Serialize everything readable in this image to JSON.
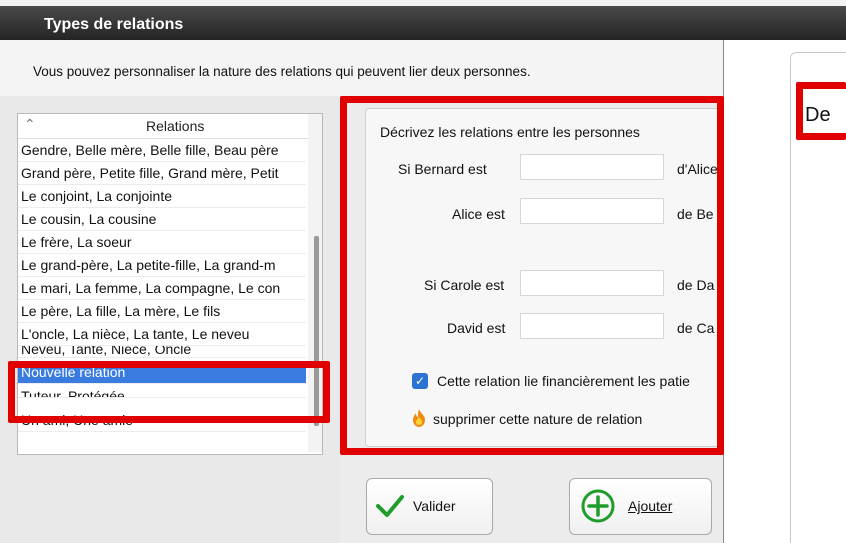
{
  "window": {
    "title": "Types de relations",
    "subtitle": "Vous pouvez personnaliser la nature des relations qui peuvent lier deux personnes."
  },
  "list": {
    "header": "Relations",
    "items": [
      "Gendre, Belle mère, Belle fille, Beau père",
      "Grand père, Petite fille, Grand mère, Petit",
      "Le conjoint, La conjointe",
      "Le cousin, La cousine",
      "Le frère, La soeur",
      "Le grand-père, La petite-fille, La grand-m",
      "Le mari, La femme, La compagne, Le con",
      "Le père, La fille, La mère, Le fils",
      "L'oncle, La nièce, La tante, Le neveu",
      "Neveu, Tante, Nièce, Oncle",
      "Nouvelle relation",
      "Tuteur, Protégée",
      "Un ami, Une amie"
    ],
    "selected_index": 10
  },
  "form": {
    "title": "Décrivez les relations entre les personnes",
    "row1_label": "Si Bernard est",
    "row1_value": "",
    "row1_suffix": "d'Alice",
    "row2_label": "Alice est",
    "row2_value": "",
    "row2_suffix": "de Be",
    "row3_label": "Si Carole est",
    "row3_value": "",
    "row3_suffix": "de Da",
    "row4_label": "David est",
    "row4_value": "",
    "row4_suffix": "de Ca",
    "checkbox_label": "Cette relation lie financièrement les patie",
    "checkbox_checked": true,
    "delete_label": "supprimer cette nature de relation"
  },
  "buttons": {
    "validate_label": "Valider",
    "add_label": "Ajouter"
  },
  "right_panel": {
    "text": "De"
  },
  "colors": {
    "highlight": "#e00000",
    "selection": "#3a7be0",
    "check": "#1f9d2b"
  }
}
